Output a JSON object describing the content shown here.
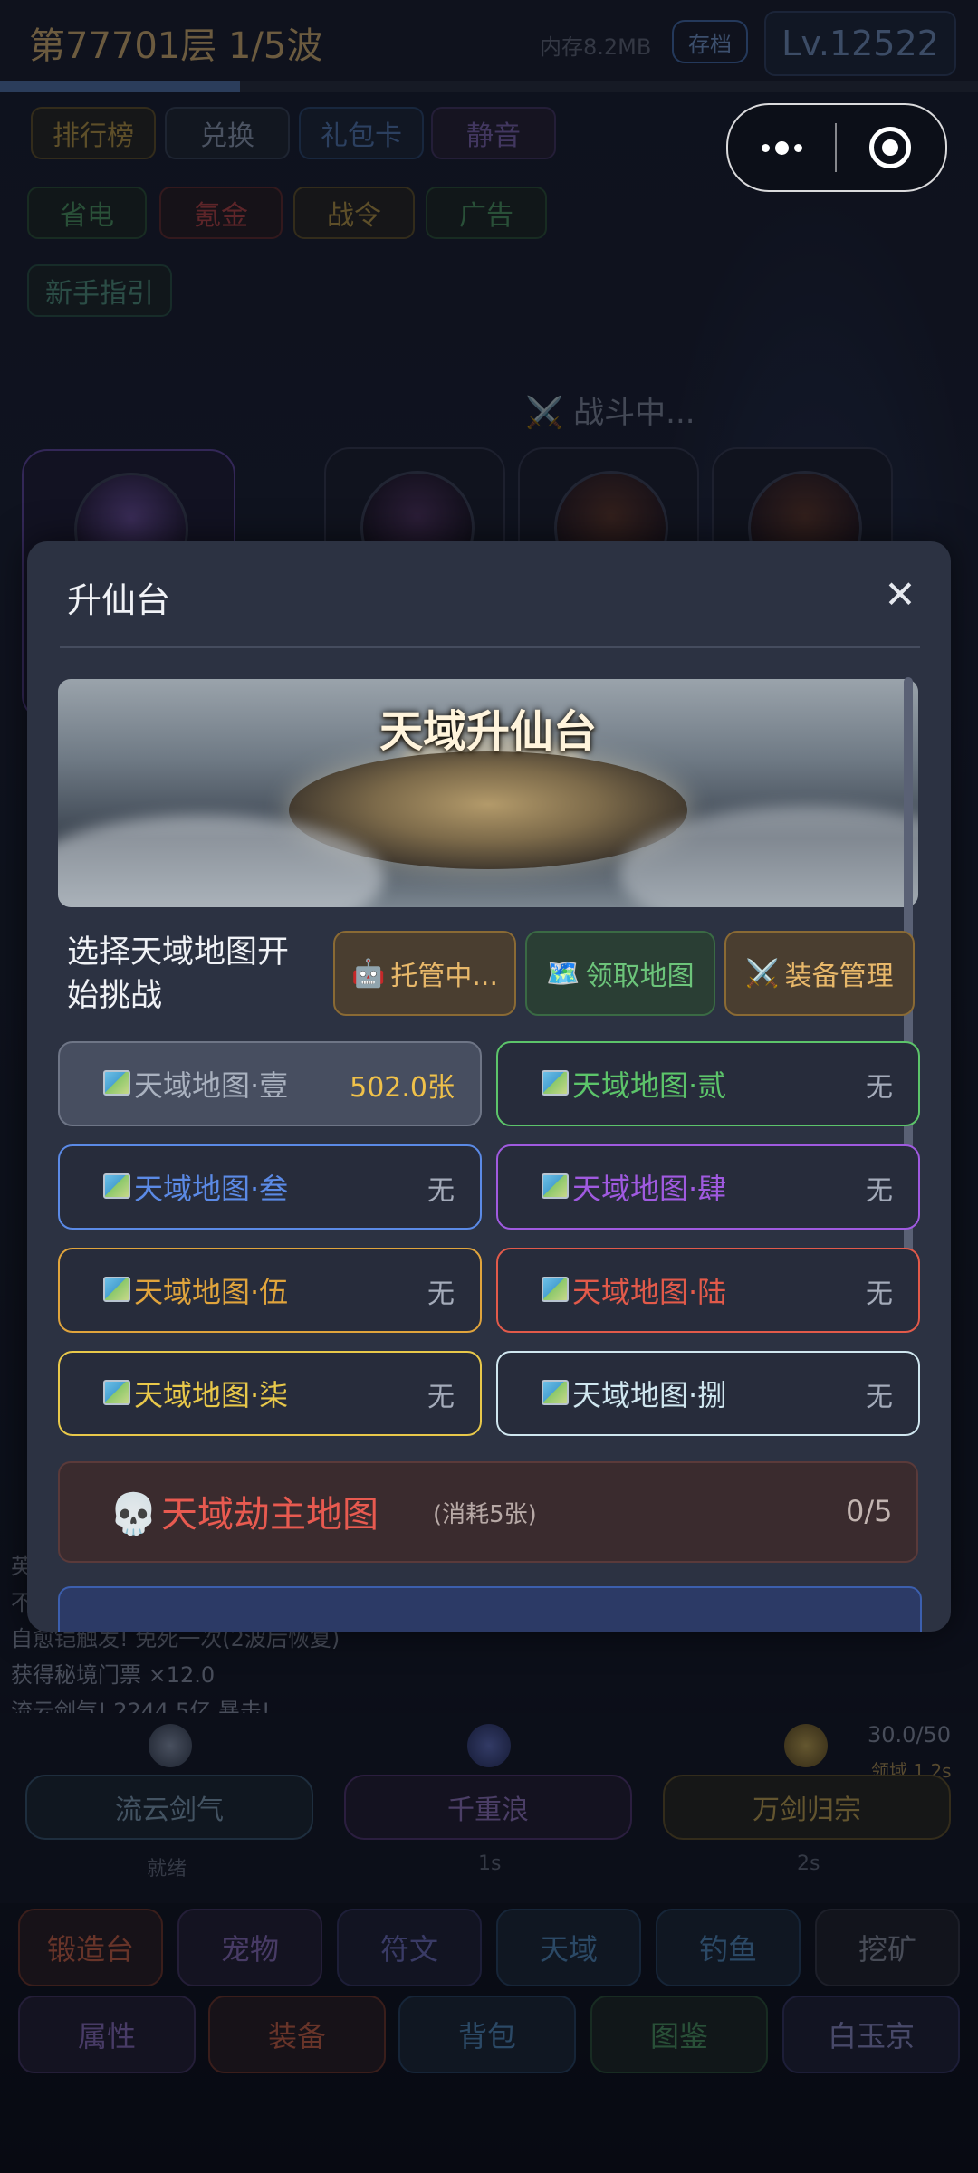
{
  "status_bar": {
    "level_wave": "第77701层  1/5波",
    "memory": "内存8.2MB",
    "save": "存档",
    "level": "Lv.12522",
    "progress": 0.245
  },
  "menu_buttons": {
    "row1": [
      "排行榜",
      "兑换",
      "礼包卡",
      "静音"
    ],
    "row2": [
      "省电",
      "氪金",
      "战令",
      "广告"
    ],
    "row3": [
      "新手指引"
    ]
  },
  "battle": {
    "status": "⚔️ 战斗中..."
  },
  "combat_log": [
    "英",
    "不",
    "自愈铠触发! 免死一次(2波后恢复)",
    "获得秘境门票 ×12.0",
    "流云剑气! 2244.5亿 暴击!"
  ],
  "skills": [
    {
      "name": "流云剑气",
      "state": "就绪"
    },
    {
      "name": "千重浪",
      "state": "1s"
    },
    {
      "name": "万剑归宗",
      "state": "2s"
    }
  ],
  "skill_energy": "30.0/50",
  "domain_timer": "领域 1.2s",
  "bottom_nav": {
    "row1": [
      "锻造台",
      "宠物",
      "符文",
      "天域",
      "钓鱼",
      "挖矿"
    ],
    "row2": [
      "属性",
      "装备",
      "背包",
      "图鉴",
      "白玉京"
    ]
  },
  "modal": {
    "title": "升仙台",
    "close": "✕",
    "banner_title": "天域升仙台",
    "choose_prompt": "选择天域地图开始挑战",
    "actions": [
      {
        "icon": "🤖",
        "label": "托管中..."
      },
      {
        "icon": "🗺️",
        "label": "领取地图"
      },
      {
        "icon": "⚔️",
        "label": "装备管理"
      }
    ],
    "maps": [
      {
        "name": "天域地图·壹",
        "count": "502.0张",
        "color": "#a9b1bf"
      },
      {
        "name": "天域地图·贰",
        "count": "无",
        "color": "#5cc46a"
      },
      {
        "name": "天域地图·叁",
        "count": "无",
        "color": "#5b8ae6"
      },
      {
        "name": "天域地图·肆",
        "count": "无",
        "color": "#a05ae0"
      },
      {
        "name": "天域地图·伍",
        "count": "无",
        "color": "#e0a43c"
      },
      {
        "name": "天域地图·陆",
        "count": "无",
        "color": "#e25a4a"
      },
      {
        "name": "天域地图·柒",
        "count": "无",
        "color": "#e8c84a"
      },
      {
        "name": "天域地图·捌",
        "count": "无",
        "color": "#cfe6ef"
      }
    ],
    "boss_map": {
      "icon": "💀",
      "name": "天域劫主地图",
      "note": "(消耗5张)",
      "progress": "0/5"
    }
  }
}
